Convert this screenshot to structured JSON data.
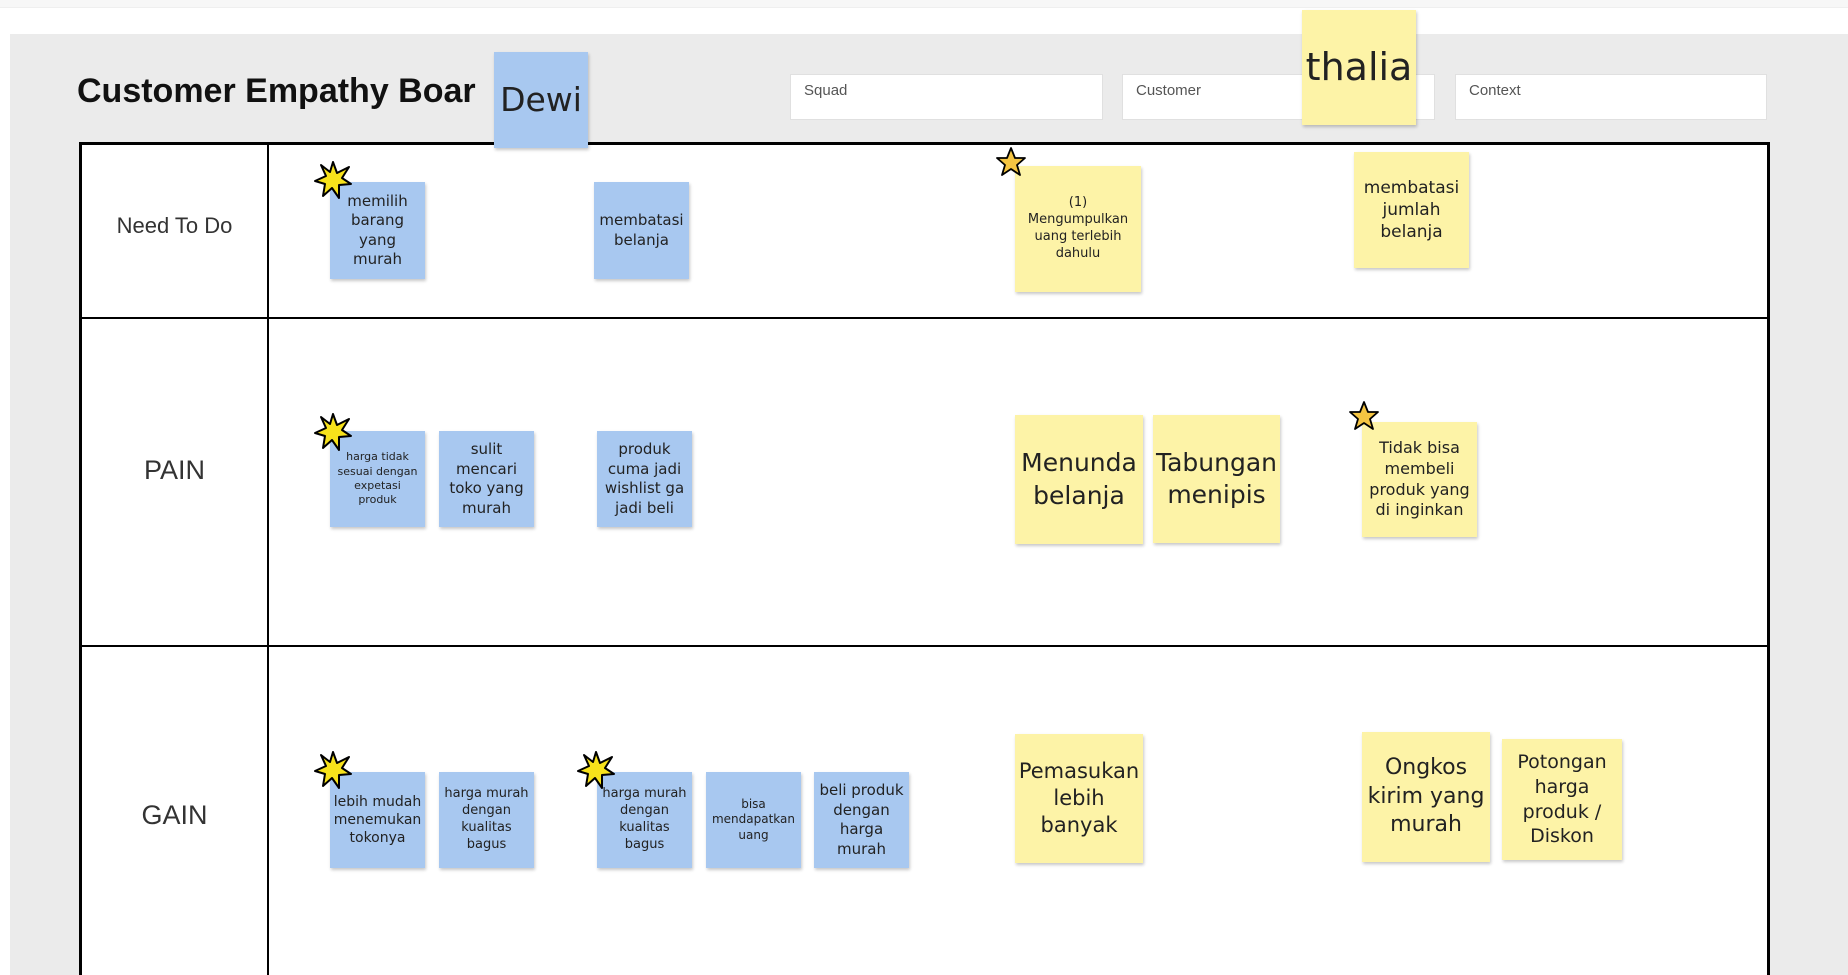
{
  "board": {
    "title": "Customer Empathy Boar",
    "fields": {
      "squad": "Squad",
      "customer": "Customer",
      "context": "Context"
    },
    "name_tags": {
      "dewi": "Dewi",
      "thalia": "thalia"
    }
  },
  "rows": {
    "need_to_do": "Need To Do",
    "pain": "PAIN",
    "gain": "GAIN"
  },
  "notes": {
    "n1": "memilih barang yang murah",
    "n2": "membatasi belanja",
    "n3": "(1) Mengumpulkan uang terlebih dahulu",
    "n4": "membatasi jumlah belanja",
    "p1": "harga tidak sesuai dengan expetasi produk",
    "p2": "sulit mencari toko yang murah",
    "p3": "produk cuma jadi wishlist ga jadi beli",
    "p4": "Menunda belanja",
    "p5": "Tabungan menipis",
    "p6": "Tidak bisa membeli produk yang di inginkan",
    "g1": "lebih mudah menemukan tokonya",
    "g2": "harga murah dengan kualitas bagus",
    "g3": "harga murah dengan kualitas bagus",
    "g4": "bisa mendapatkan uang",
    "g5": "beli produk dengan harga murah",
    "g6": "Pemasukan lebih banyak",
    "g7": "Ongkos kirim yang murah",
    "g8": "Potongan harga produk / Diskon"
  },
  "colors": {
    "blue_note": "#a8c8f0",
    "yellow_note": "#fdf3a7",
    "star_vote": "#f7e21b",
    "star_outline": "#f5c542"
  },
  "icons": {
    "vote": "star-burst-icon",
    "favorite": "star-outline-icon"
  }
}
